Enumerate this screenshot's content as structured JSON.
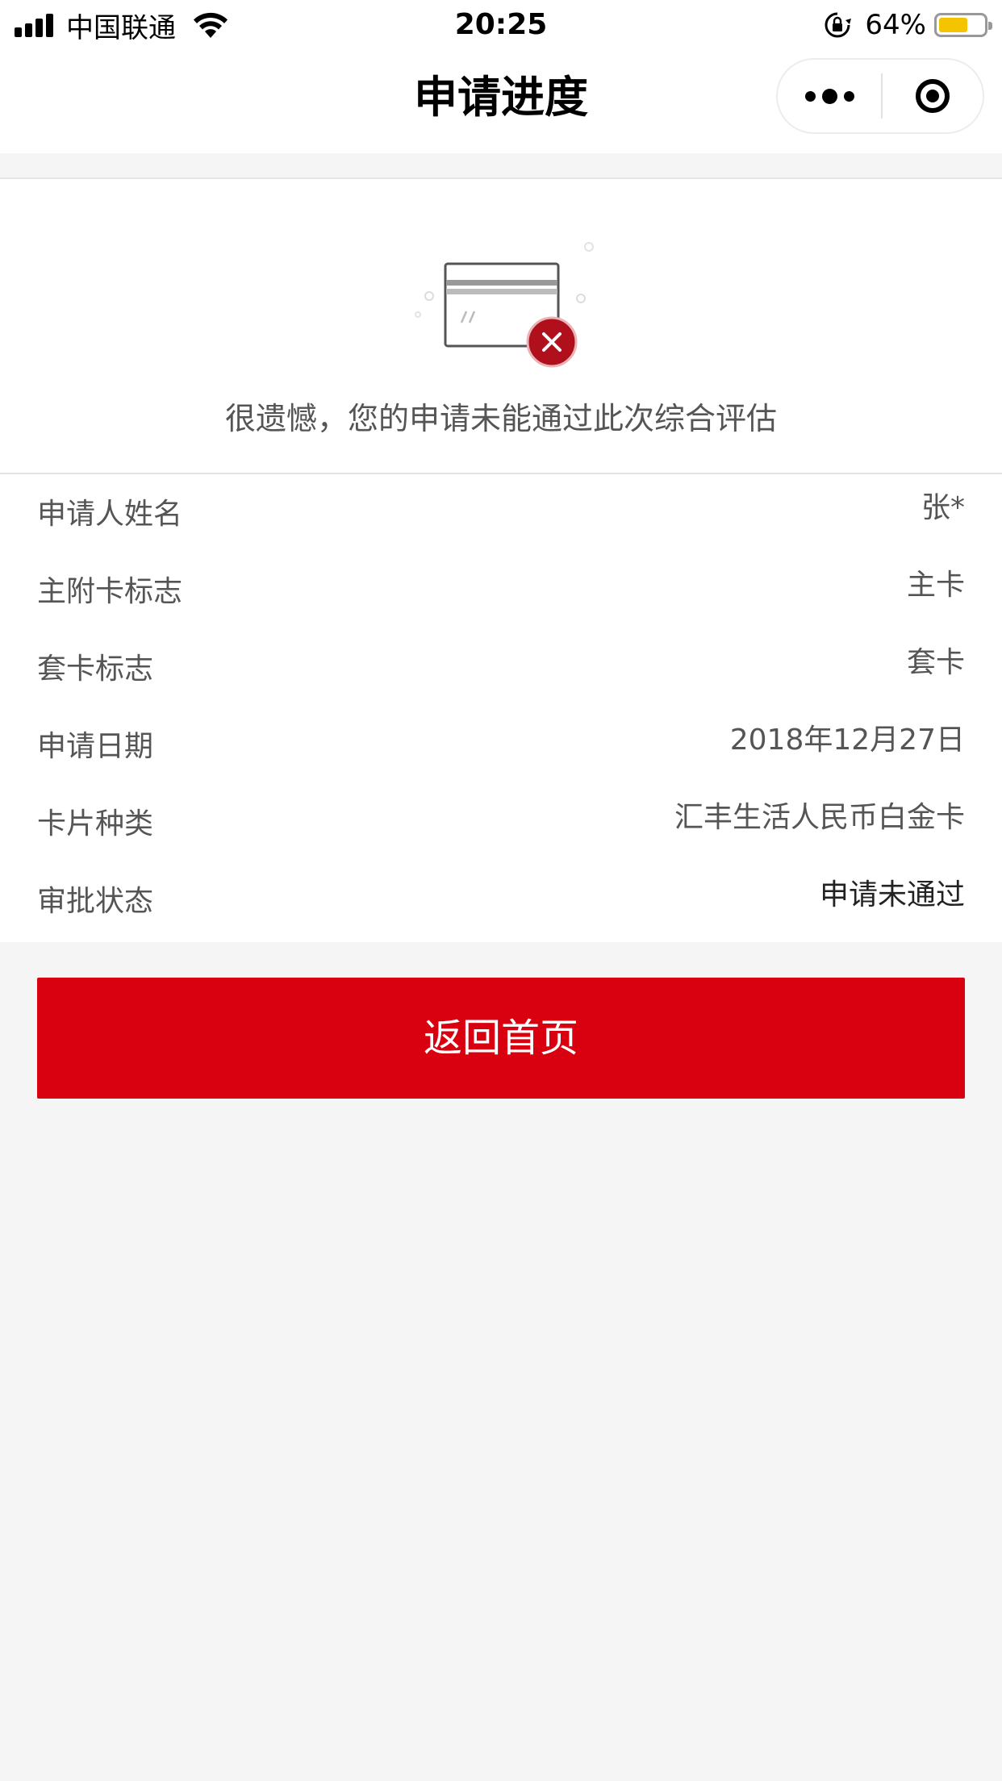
{
  "status_bar": {
    "carrier": "中国联通",
    "time": "20:25",
    "battery_percent": "64%",
    "battery_level": 0.64,
    "signal_icon": "signal-bars-icon",
    "wifi_icon": "wifi-icon",
    "orientation_lock_icon": "orientation-lock-icon"
  },
  "nav": {
    "title": "申请进度",
    "more_icon": "more-dots-icon",
    "close_icon": "target-close-icon"
  },
  "result": {
    "illustration": "card-rejected-icon",
    "message": "很遗憾，您的申请未能通过此次综合评估"
  },
  "info": {
    "rows": [
      {
        "label": "申请人姓名",
        "value": "张*"
      },
      {
        "label": "主附卡标志",
        "value": "主卡"
      },
      {
        "label": "套卡标志",
        "value": "套卡"
      },
      {
        "label": "申请日期",
        "value": "2018年12月27日"
      },
      {
        "label": "卡片种类",
        "value": "汇丰生活人民币白金卡"
      },
      {
        "label": "审批状态",
        "value": "申请未通过"
      }
    ]
  },
  "actions": {
    "home_button": "返回首页"
  },
  "colors": {
    "primary_red": "#d9000f",
    "page_background": "#f5f5f5",
    "battery_yellow": "#f5c400",
    "reject_badge": "#b0101c"
  }
}
